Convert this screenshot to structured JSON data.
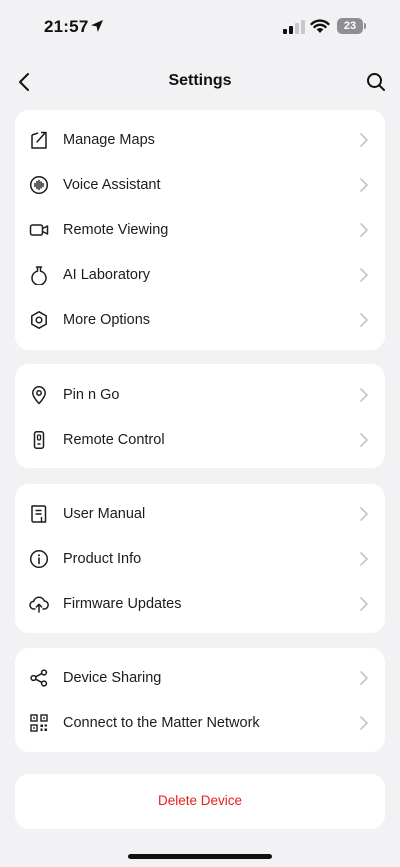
{
  "status_bar": {
    "time": "21:57",
    "battery_level": "23",
    "icons": [
      "location-arrow-icon",
      "signal-icon",
      "wifi-icon",
      "battery-icon"
    ]
  },
  "nav": {
    "title": "Settings",
    "back_icon": "chevron-left-icon",
    "search_icon": "search-icon"
  },
  "groups": [
    {
      "items": [
        {
          "label": "Manage Maps",
          "icon": "map-icon"
        },
        {
          "label": "Voice Assistant",
          "icon": "voice-wave-icon"
        },
        {
          "label": "Remote Viewing",
          "icon": "video-camera-icon"
        },
        {
          "label": "AI Laboratory",
          "icon": "flask-icon"
        },
        {
          "label": "More Options",
          "icon": "hexagon-nut-icon"
        }
      ]
    },
    {
      "items": [
        {
          "label": "Pin n Go",
          "icon": "location-pin-icon"
        },
        {
          "label": "Remote Control",
          "icon": "remote-control-icon"
        }
      ]
    },
    {
      "items": [
        {
          "label": "User Manual",
          "icon": "manual-book-icon"
        },
        {
          "label": "Product Info",
          "icon": "info-circle-icon"
        },
        {
          "label": "Firmware Updates",
          "icon": "cloud-upload-icon"
        }
      ]
    },
    {
      "items": [
        {
          "label": "Device Sharing",
          "icon": "share-icon"
        },
        {
          "label": "Connect to the Matter Network",
          "icon": "qr-code-icon"
        }
      ]
    }
  ],
  "delete": {
    "label": "Delete Device",
    "color": "#e8201c"
  },
  "colors": {
    "background": "#f2f2f4",
    "card": "#ffffff",
    "text": "#1c1c1e",
    "chevron": "#c4c4c8"
  }
}
